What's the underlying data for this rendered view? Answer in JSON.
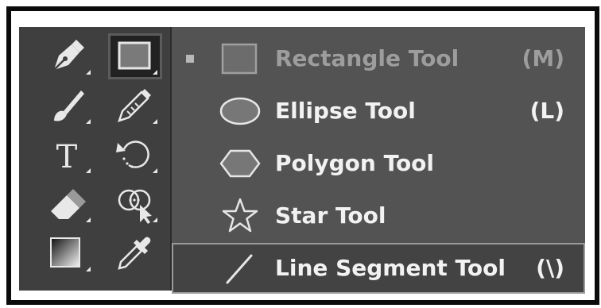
{
  "toolbar": {
    "tools": [
      {
        "icon": "pen-icon",
        "has_flyout": true
      },
      {
        "icon": "rectangle-icon",
        "has_flyout": true,
        "active": true
      },
      {
        "icon": "paintbrush-icon",
        "has_flyout": true
      },
      {
        "icon": "shaper-pencil-icon",
        "has_flyout": true
      },
      {
        "icon": "type-icon",
        "has_flyout": true
      },
      {
        "icon": "rotate-icon",
        "has_flyout": true
      },
      {
        "icon": "eraser-icon",
        "has_flyout": true
      },
      {
        "icon": "shape-builder-icon",
        "has_flyout": true
      },
      {
        "icon": "gradient-icon",
        "has_flyout": true
      },
      {
        "icon": "eyedropper-icon",
        "has_flyout": false
      }
    ]
  },
  "flyout": {
    "items": [
      {
        "label": "Rectangle Tool",
        "shortcut": "(M)",
        "icon": "rectangle-icon",
        "current": true
      },
      {
        "label": "Ellipse Tool",
        "shortcut": "(L)",
        "icon": "ellipse-icon"
      },
      {
        "label": "Polygon Tool",
        "shortcut": "",
        "icon": "polygon-icon"
      },
      {
        "label": "Star Tool",
        "shortcut": "",
        "icon": "star-icon"
      },
      {
        "label": "Line Segment Tool",
        "shortcut": "(\\)",
        "icon": "line-segment-icon",
        "highlighted": true
      }
    ]
  },
  "colors": {
    "toolbar_bg": "#3f3f3f",
    "flyout_bg": "#535353",
    "highlight_bg": "#434343",
    "label_text": "#f2f2f2",
    "dimmed_text": "#9d9d9d"
  }
}
